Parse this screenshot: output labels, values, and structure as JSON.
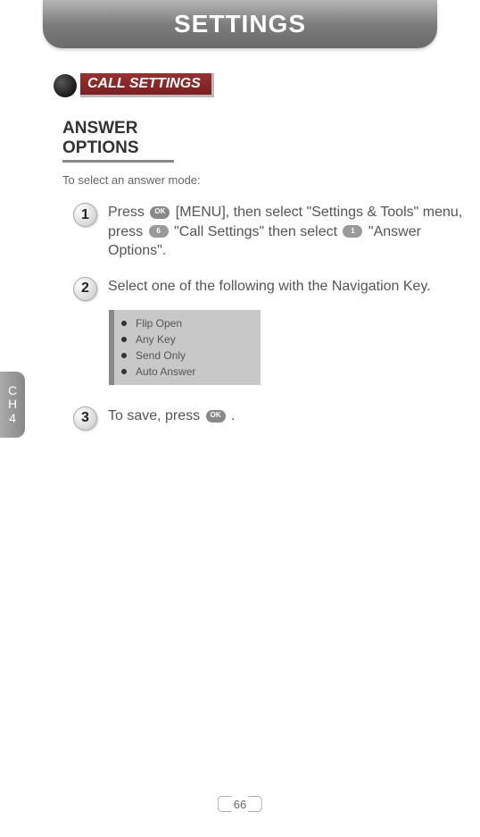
{
  "header": {
    "title": "SETTINGS"
  },
  "section": {
    "label": "CALL SETTINGS"
  },
  "subsection": {
    "title": "ANSWER OPTIONS",
    "subtext": "To select an answer mode:"
  },
  "steps": {
    "s1": {
      "num": "1",
      "part1": "Press ",
      "part2": " [MENU], then select \"Settings & Tools\" menu, press ",
      "key6": "6",
      "part3": " \"Call Settings\" then select ",
      "key1": "1",
      "part4": " \"Answer Options\"."
    },
    "s2": {
      "num": "2",
      "text": "Select one of the following with the Navigation Key."
    },
    "s3": {
      "num": "3",
      "part1": "To save, press ",
      "part2": " ."
    }
  },
  "options": {
    "o1": "Flip Open",
    "o2": "Any Key",
    "o3": "Send Only",
    "o4": "Auto Answer"
  },
  "ok_label": "OK",
  "side_tab": {
    "l1": "C",
    "l2": "H",
    "l3": "4"
  },
  "page_number": "66"
}
